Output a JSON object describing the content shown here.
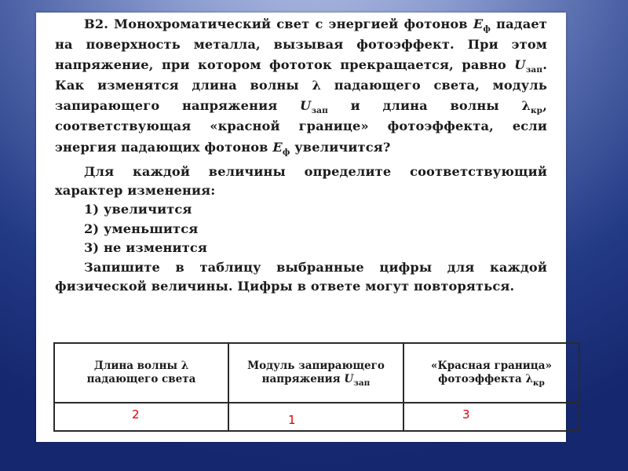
{
  "slide": {
    "background_colors": {
      "top": "#b3c0e3",
      "bottom": "#15276e"
    },
    "answer_color": "#e00000"
  },
  "problem": {
    "label": "В2.",
    "p1": {
      "s1": " Монохроматический свет с энергией фотонов ",
      "E": "E",
      "E_sub": "ф",
      "s2": " падает на поверхность металла, вызывая фотоэффект. При этом напряжение, при котором фототок прекращается, равно ",
      "U": "U",
      "U_sub": "зап",
      "s3": ". Как изменятся длина волны ",
      "lambda": "λ",
      "s4": " падающего света, модуль запирающего напряжения ",
      "U2": "U",
      "U2_sub": "зап",
      "s5": " и длина волны ",
      "lambda2": "λ",
      "lambda2_sub": "кр",
      "s6": ", соответствующая «красной границе» фотоэффекта, если энергия падающих фотонов ",
      "E2": "E",
      "E2_sub": "ф",
      "s7": " увеличится?"
    },
    "instruction": "Для каждой величины определите соответствующий характер изменения:",
    "options": [
      "1) увеличится",
      "2) уменьшится",
      "3) не изменится"
    ],
    "closing": "Запишите в таблицу выбранные цифры для каждой физической величины. Цифры в ответе могут повторяться."
  },
  "table": {
    "headers": [
      {
        "text": "Длина волны λ падающего света"
      },
      {
        "text": "Модуль запирающего напряжения ",
        "var": "U",
        "sub": "зап"
      },
      {
        "text": "«Красная граница» фотоэффекта ",
        "var": "λ",
        "sub": "кр"
      }
    ],
    "answers": [
      "2",
      "1",
      "3"
    ]
  }
}
